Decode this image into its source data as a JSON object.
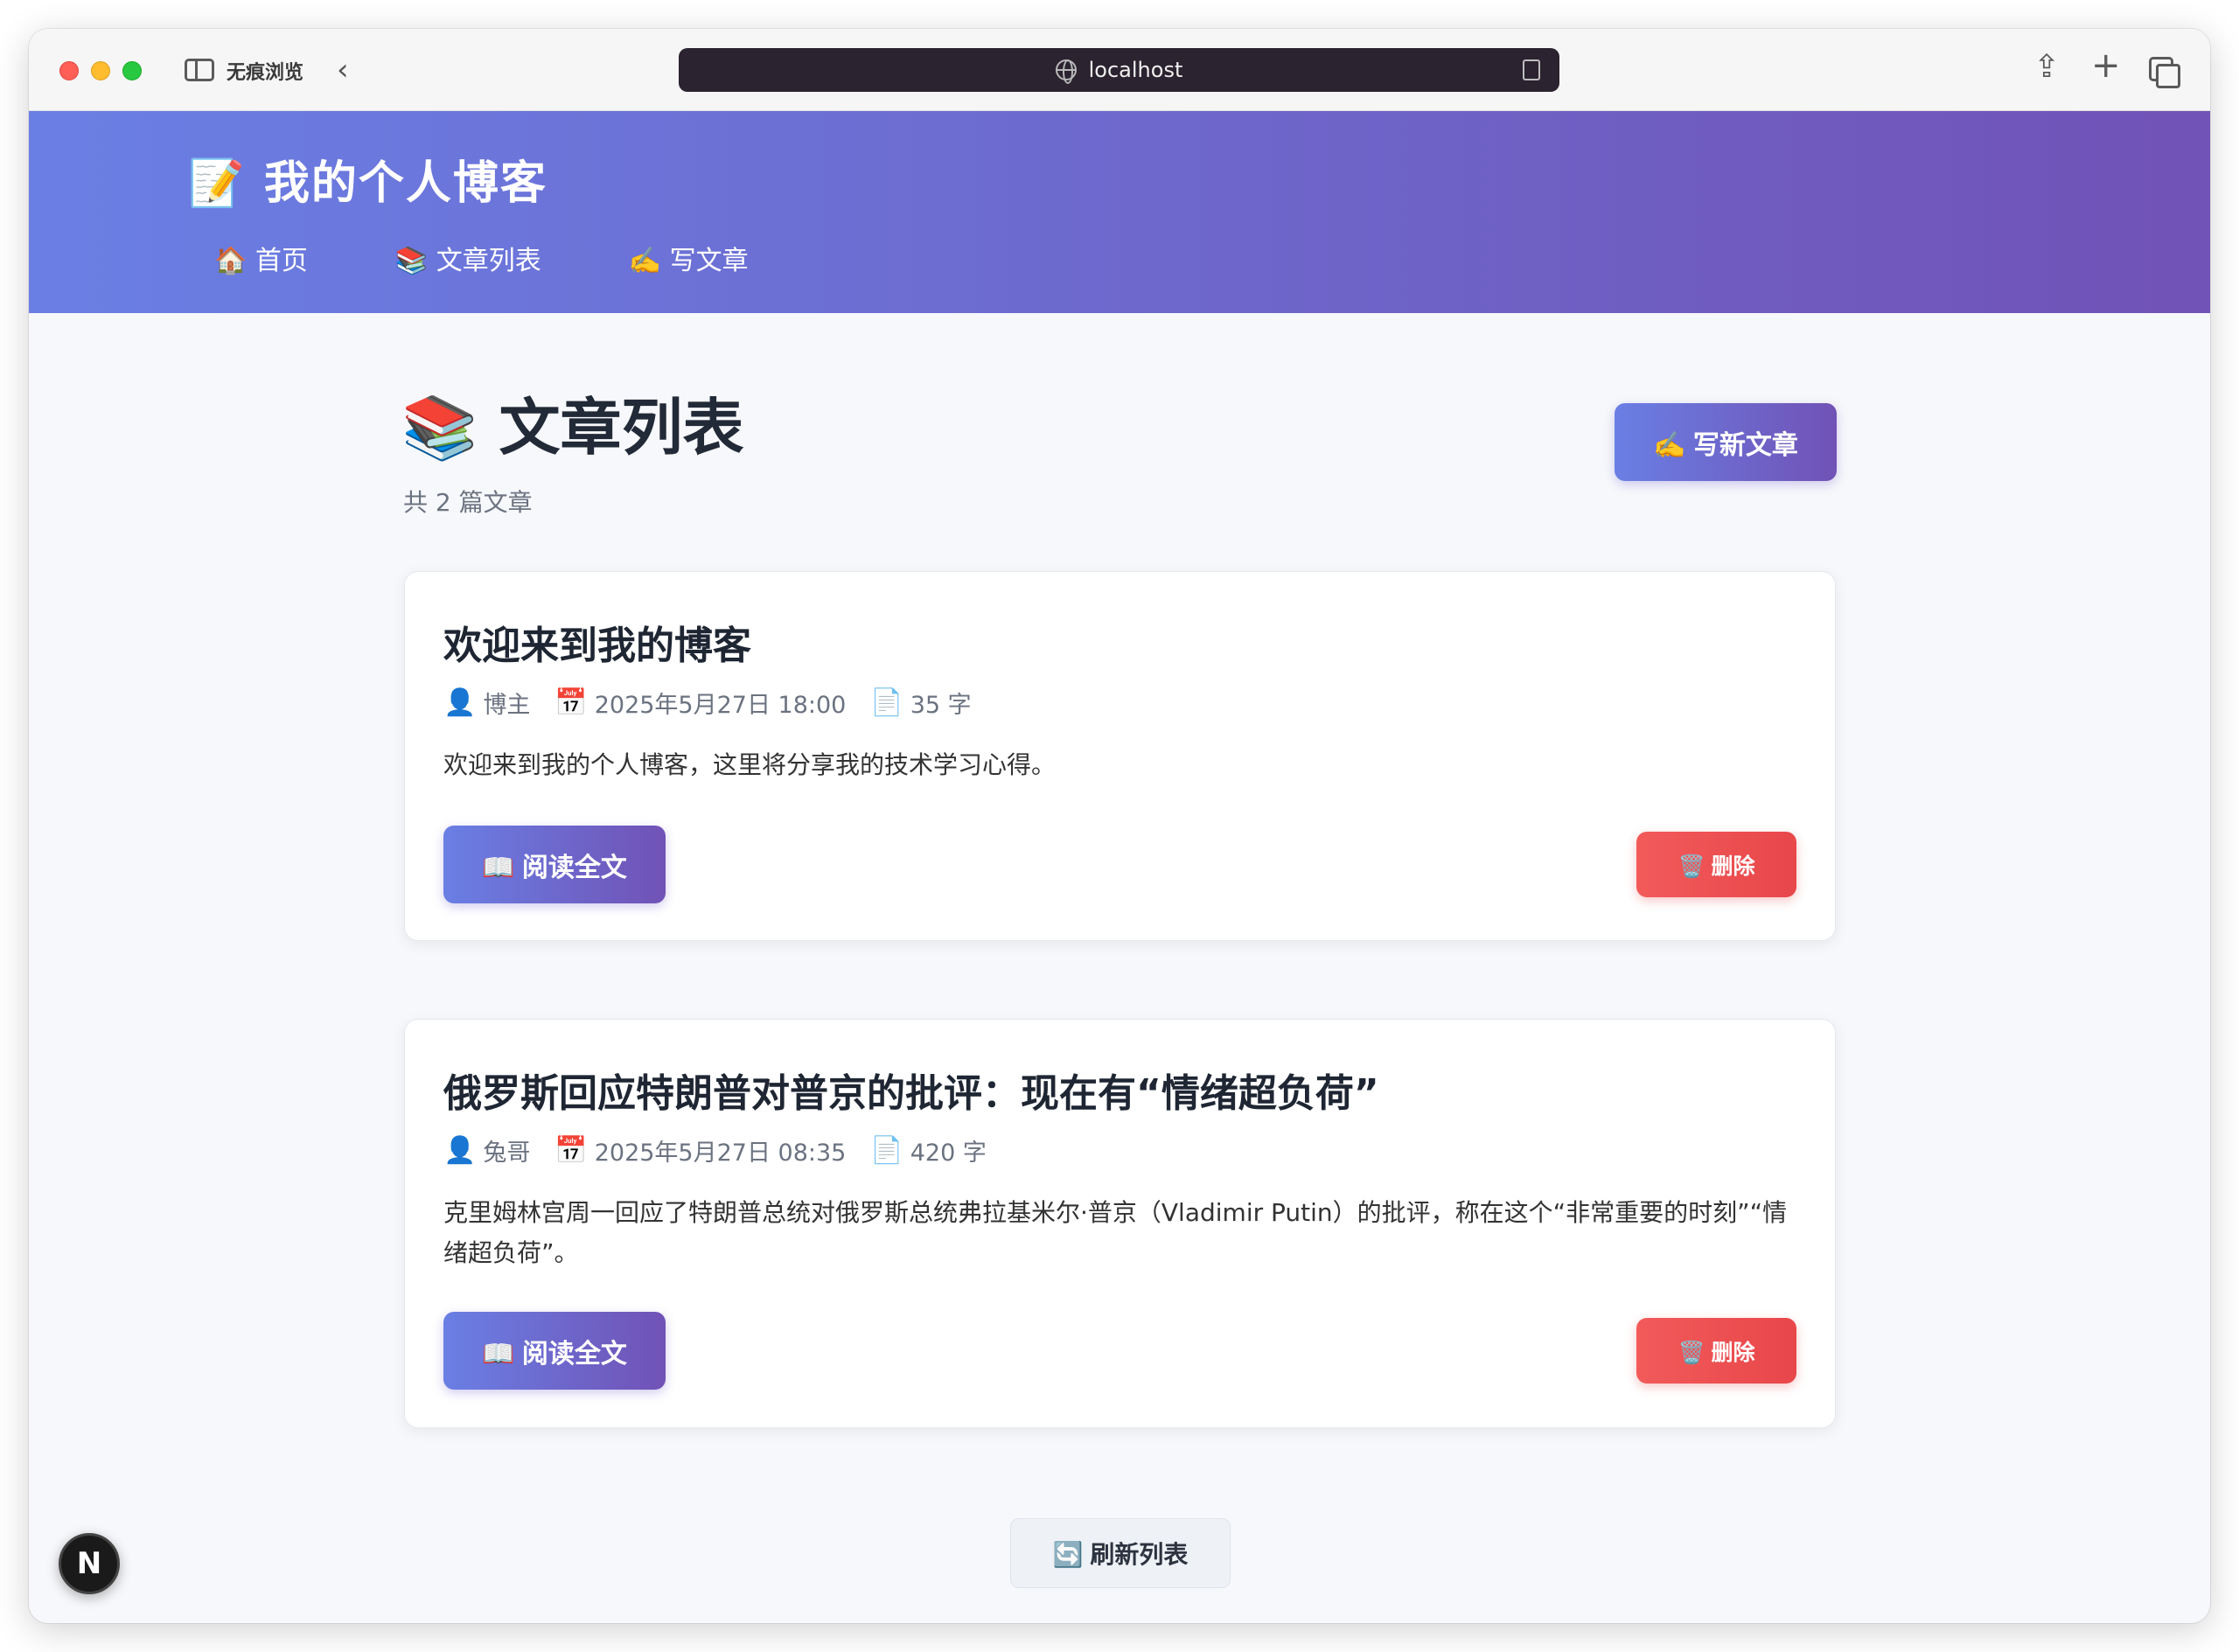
{
  "browser": {
    "private_label": "无痕浏览",
    "url": "localhost",
    "back_icon": "chevron-left-icon",
    "share_icon": "share-icon",
    "new_tab_icon": "plus-icon",
    "tabs_icon": "tabs-overview-icon"
  },
  "header": {
    "site_title": "📝 我的个人博客",
    "nav": [
      {
        "label": "🏠 首页"
      },
      {
        "label": "📚 文章列表"
      },
      {
        "label": "✍️ 写文章"
      }
    ],
    "gradient_start": "#6a7fe4",
    "gradient_end": "#7152b6"
  },
  "main": {
    "page_title": "📚 文章列表",
    "article_count": "共 2 篇文章",
    "write_new_label": "✍️ 写新文章",
    "refresh_label": "🔄 刷新列表"
  },
  "articles": [
    {
      "title": "欢迎来到我的博客",
      "author": "博主",
      "date": "2025年5月27日 18:00",
      "words": "35 字",
      "excerpt": "欢迎来到我的个人博客，这里将分享我的技术学习心得。",
      "read_label": "📖 阅读全文",
      "delete_label": "🗑️ 删除"
    },
    {
      "title": "俄罗斯回应特朗普对普京的批评：现在有“情绪超负荷”",
      "author": "兔哥",
      "date": "2025年5月27日 08:35",
      "words": "420 字",
      "excerpt": "克里姆林宫周一回应了特朗普总统对俄罗斯总统弗拉基米尔·普京（Vladimir Putin）的批评，称在这个“非常重要的时刻”“情绪超负荷”。",
      "read_label": "📖 阅读全文",
      "delete_label": "🗑️ 删除"
    }
  ],
  "meta_icons": {
    "author": "👤",
    "date": "📅",
    "words": "📄"
  },
  "dev_badge": "N",
  "colors": {
    "accent": "#6a7fe4",
    "danger": "#e8474a",
    "page_bg": "#f7f8fb"
  }
}
